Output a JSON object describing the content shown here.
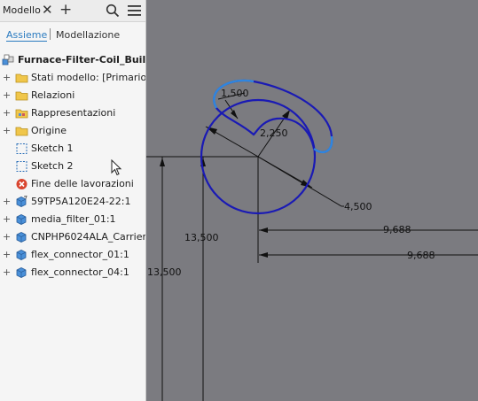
{
  "panel": {
    "tab_label": "Modello",
    "close_glyph": "✕",
    "plus_glyph": "+",
    "subtab_active": "Assieme",
    "subtab_inactive": "Modellazione"
  },
  "tree": {
    "root": "Furnace-Filter-Coil_Buildu",
    "items": [
      {
        "label": "Stati modello: [Primario]",
        "icon": "folder-icon"
      },
      {
        "label": "Relazioni",
        "icon": "folder-icon"
      },
      {
        "label": "Rappresentazioni",
        "icon": "folder-representations-icon"
      },
      {
        "label": "Origine",
        "icon": "folder-icon"
      },
      {
        "label": "Sketch 1",
        "icon": "sketch-icon"
      },
      {
        "label": "Sketch 2",
        "icon": "sketch-icon"
      },
      {
        "label": "Fine delle lavorazioni",
        "icon": "end-of-part-icon"
      },
      {
        "label": "59TP5A120E24-22:1",
        "icon": "part-icon"
      },
      {
        "label": "media_filter_01:1",
        "icon": "part-icon"
      },
      {
        "label": "CNPHP6024ALA_Carrier:1",
        "icon": "part-icon"
      },
      {
        "label": "flex_connector_01:1",
        "icon": "part-icon"
      },
      {
        "label": "flex_connector_04:1",
        "icon": "part-icon"
      }
    ]
  },
  "sketch": {
    "dimensions": {
      "d1": "1,500",
      "d2": "2,250",
      "d3": "4,500",
      "d4": "9,688",
      "d5": "9,688",
      "d6": "13,500",
      "d7": "13,500"
    },
    "colors": {
      "profile": "#1a1ab4",
      "selected": "#2f86e0",
      "dimension": "#111111"
    }
  }
}
